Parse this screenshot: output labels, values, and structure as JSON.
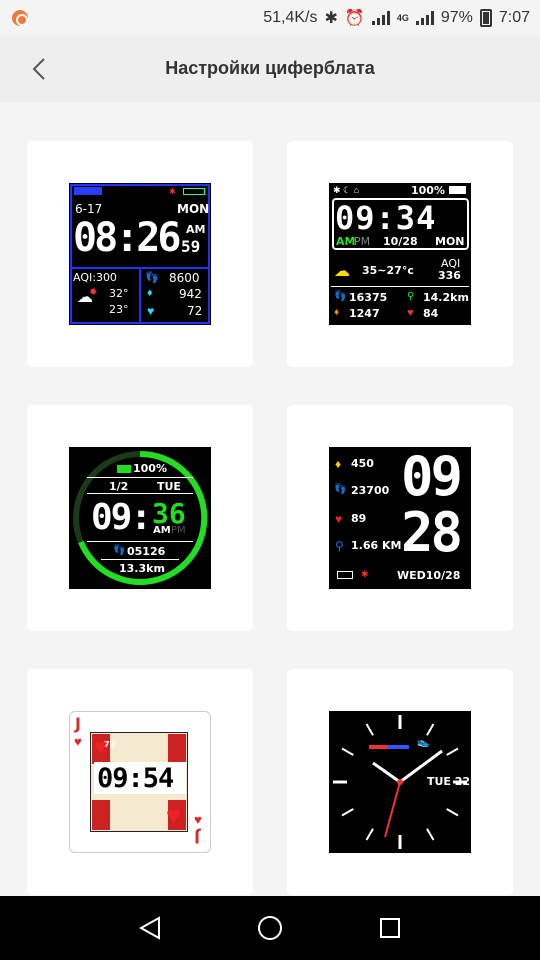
{
  "status_bar": {
    "speed": "51,4K/s",
    "network": "4G",
    "battery": "97%",
    "time": "7:07"
  },
  "header": {
    "title": "Настройки циферблата"
  },
  "faces": {
    "f1": {
      "date": "6-17",
      "day": "MON",
      "time": "08:26",
      "ampm": "AM",
      "seconds": "59",
      "aqi": "AQI:300",
      "temp_high": "32°",
      "temp_low": "23°",
      "steps": "8600",
      "calories": "942",
      "heart": "72"
    },
    "f2": {
      "battery": "100%",
      "time": "09:34",
      "am": "AM",
      "pm": "PM",
      "date": "10/28",
      "day": "MON",
      "temp": "35~27°c",
      "aqi_label": "AQI",
      "aqi_value": "336",
      "steps": "16375",
      "distance": "14.2km",
      "calories": "1247",
      "heart": "84"
    },
    "f3": {
      "battery": "100%",
      "page": "1/2",
      "day": "TUE",
      "time_hour": "09:",
      "time_min": "36",
      "am": "AM",
      "pm": "PM",
      "steps": "05126",
      "distance": "13.3km"
    },
    "f4": {
      "calories": "450",
      "steps": "23700",
      "heart": "89",
      "distance": "1.66 KM",
      "hour": "09",
      "minute": "28",
      "date": "WED10/28"
    },
    "f5": {
      "rank_top": "J",
      "heart_value": "72",
      "time": "09:54",
      "rank_bottom": "J"
    },
    "f6": {
      "date": "TUE 22"
    }
  },
  "colors": {
    "accent_cyan": "#20e0ff",
    "accent_green": "#22dd22",
    "accent_red": "#e23030",
    "face1_frame": "#2233ff"
  }
}
